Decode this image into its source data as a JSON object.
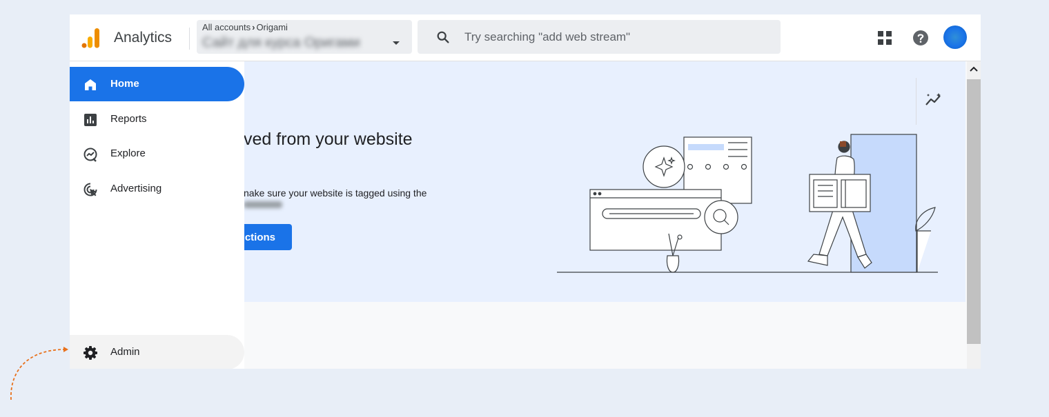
{
  "header": {
    "app_title": "Analytics",
    "account": {
      "crumb_root": "All accounts",
      "crumb_account": "Origami",
      "property_name": "Сайт для курса Оригами"
    },
    "search": {
      "placeholder": "Try searching \"add web stream\"",
      "value": ""
    },
    "icons": [
      "analytics-logo-icon",
      "search-icon",
      "apps-grid-icon",
      "help-icon",
      "avatar"
    ]
  },
  "sidebar": {
    "items": [
      {
        "label": "Home",
        "icon": "home-icon",
        "active": true
      },
      {
        "label": "Reports",
        "icon": "reports-icon",
        "active": false
      },
      {
        "label": "Explore",
        "icon": "explore-icon",
        "active": false
      },
      {
        "label": "Advertising",
        "icon": "advertising-icon",
        "active": false
      }
    ],
    "admin": {
      "label": "Admin",
      "icon": "gear-icon"
    }
  },
  "hero": {
    "title": "ved from your website",
    "description": "nake sure your website is tagged using the",
    "button_label": "ctions"
  },
  "colors": {
    "accent": "#1a73e8",
    "hero_bg": "#e8f0fe",
    "logo_orange": "#f9ab00",
    "logo_dark_orange": "#e37400",
    "arrow": "#e8711c"
  }
}
